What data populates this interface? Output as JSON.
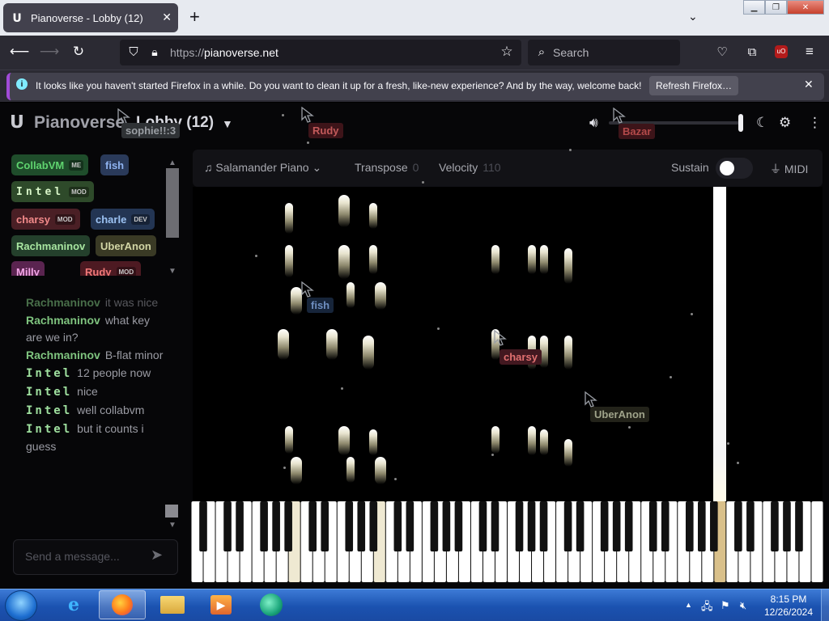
{
  "browser": {
    "tab_title": "Pianoverse - Lobby (12)",
    "url_protocol": "https://",
    "url_host": "pianoverse.net",
    "search_placeholder": "Search",
    "notification": {
      "text": "It looks like you haven't started Firefox in a while. Do you want to clean it up for a fresh, like-new experience? And by the way, welcome back!",
      "button": "Refresh Firefox…"
    }
  },
  "app": {
    "logo_text": "Pianoverse",
    "room": "Lobby (12)",
    "volume_fraction": 0.98,
    "users": [
      {
        "name": "CollabVM",
        "tag": "ME",
        "bg": "#1f4d2b",
        "fg": "#5fd46f"
      },
      {
        "name": "fish",
        "tag": "",
        "bg": "#2a3a5a",
        "fg": "#8fb3f0"
      },
      {
        "name": "Intel",
        "tag": "MOD",
        "bg": "#2e4a2a",
        "fg": "#d8f5c8"
      },
      {
        "name": "charsy",
        "tag": "MOD",
        "bg": "#4a1f25",
        "fg": "#f28a8a"
      },
      {
        "name": "charle",
        "tag": "DEV",
        "bg": "#233553",
        "fg": "#9cc2f2"
      },
      {
        "name": "Rachmaninov",
        "tag": "",
        "bg": "#24402c",
        "fg": "#a8e5a0"
      },
      {
        "name": "UberAnon",
        "tag": "",
        "bg": "#3a3a25",
        "fg": "#d2d5a5"
      },
      {
        "name": "Milly",
        "tag": "",
        "bg": "#5a2450",
        "fg": "#f3a6e8"
      },
      {
        "name": "Rudy",
        "tag": "MOD",
        "bg": "#4d1a22",
        "fg": "#f07878"
      }
    ],
    "chat": [
      {
        "user": "Rachmaninov",
        "text": "it was nice",
        "faded": true
      },
      {
        "user": "Rachmaninov",
        "text": "what key are we in?"
      },
      {
        "user": "Rachmaninov",
        "text": "B-flat minor"
      },
      {
        "user": "Intel",
        "text": "12 people now"
      },
      {
        "user": "Intel",
        "text": "nice"
      },
      {
        "user": "Intel",
        "text": "well collabvm"
      },
      {
        "user": "Intel",
        "text": "but it counts i guess"
      }
    ],
    "chat_placeholder": "Send a message...",
    "toolbar": {
      "instrument": "Salamander Piano",
      "transpose_label": "Transpose",
      "transpose_value": "0",
      "velocity_label": "Velocity",
      "velocity_value": "110",
      "sustain_label": "Sustain",
      "sustain_on": false,
      "midi_label": "MIDI"
    },
    "cursors": [
      {
        "name": "sophie!!:3",
        "color": "#2f3235",
        "fg": "#9a9ea3"
      },
      {
        "name": "Rudy",
        "color": "#3d1419",
        "fg": "#c25a5a"
      },
      {
        "name": "Bazar",
        "color": "#3d1419",
        "fg": "#b44a4a"
      },
      {
        "name": "fish",
        "color": "#17253a",
        "fg": "#6f8fc0"
      },
      {
        "name": "charsy",
        "color": "#421820",
        "fg": "#e07070"
      },
      {
        "name": "UberAnon",
        "color": "#23231a",
        "fg": "#9fa38a"
      }
    ]
  },
  "taskbar": {
    "time": "8:15 PM",
    "date": "12/26/2024"
  }
}
